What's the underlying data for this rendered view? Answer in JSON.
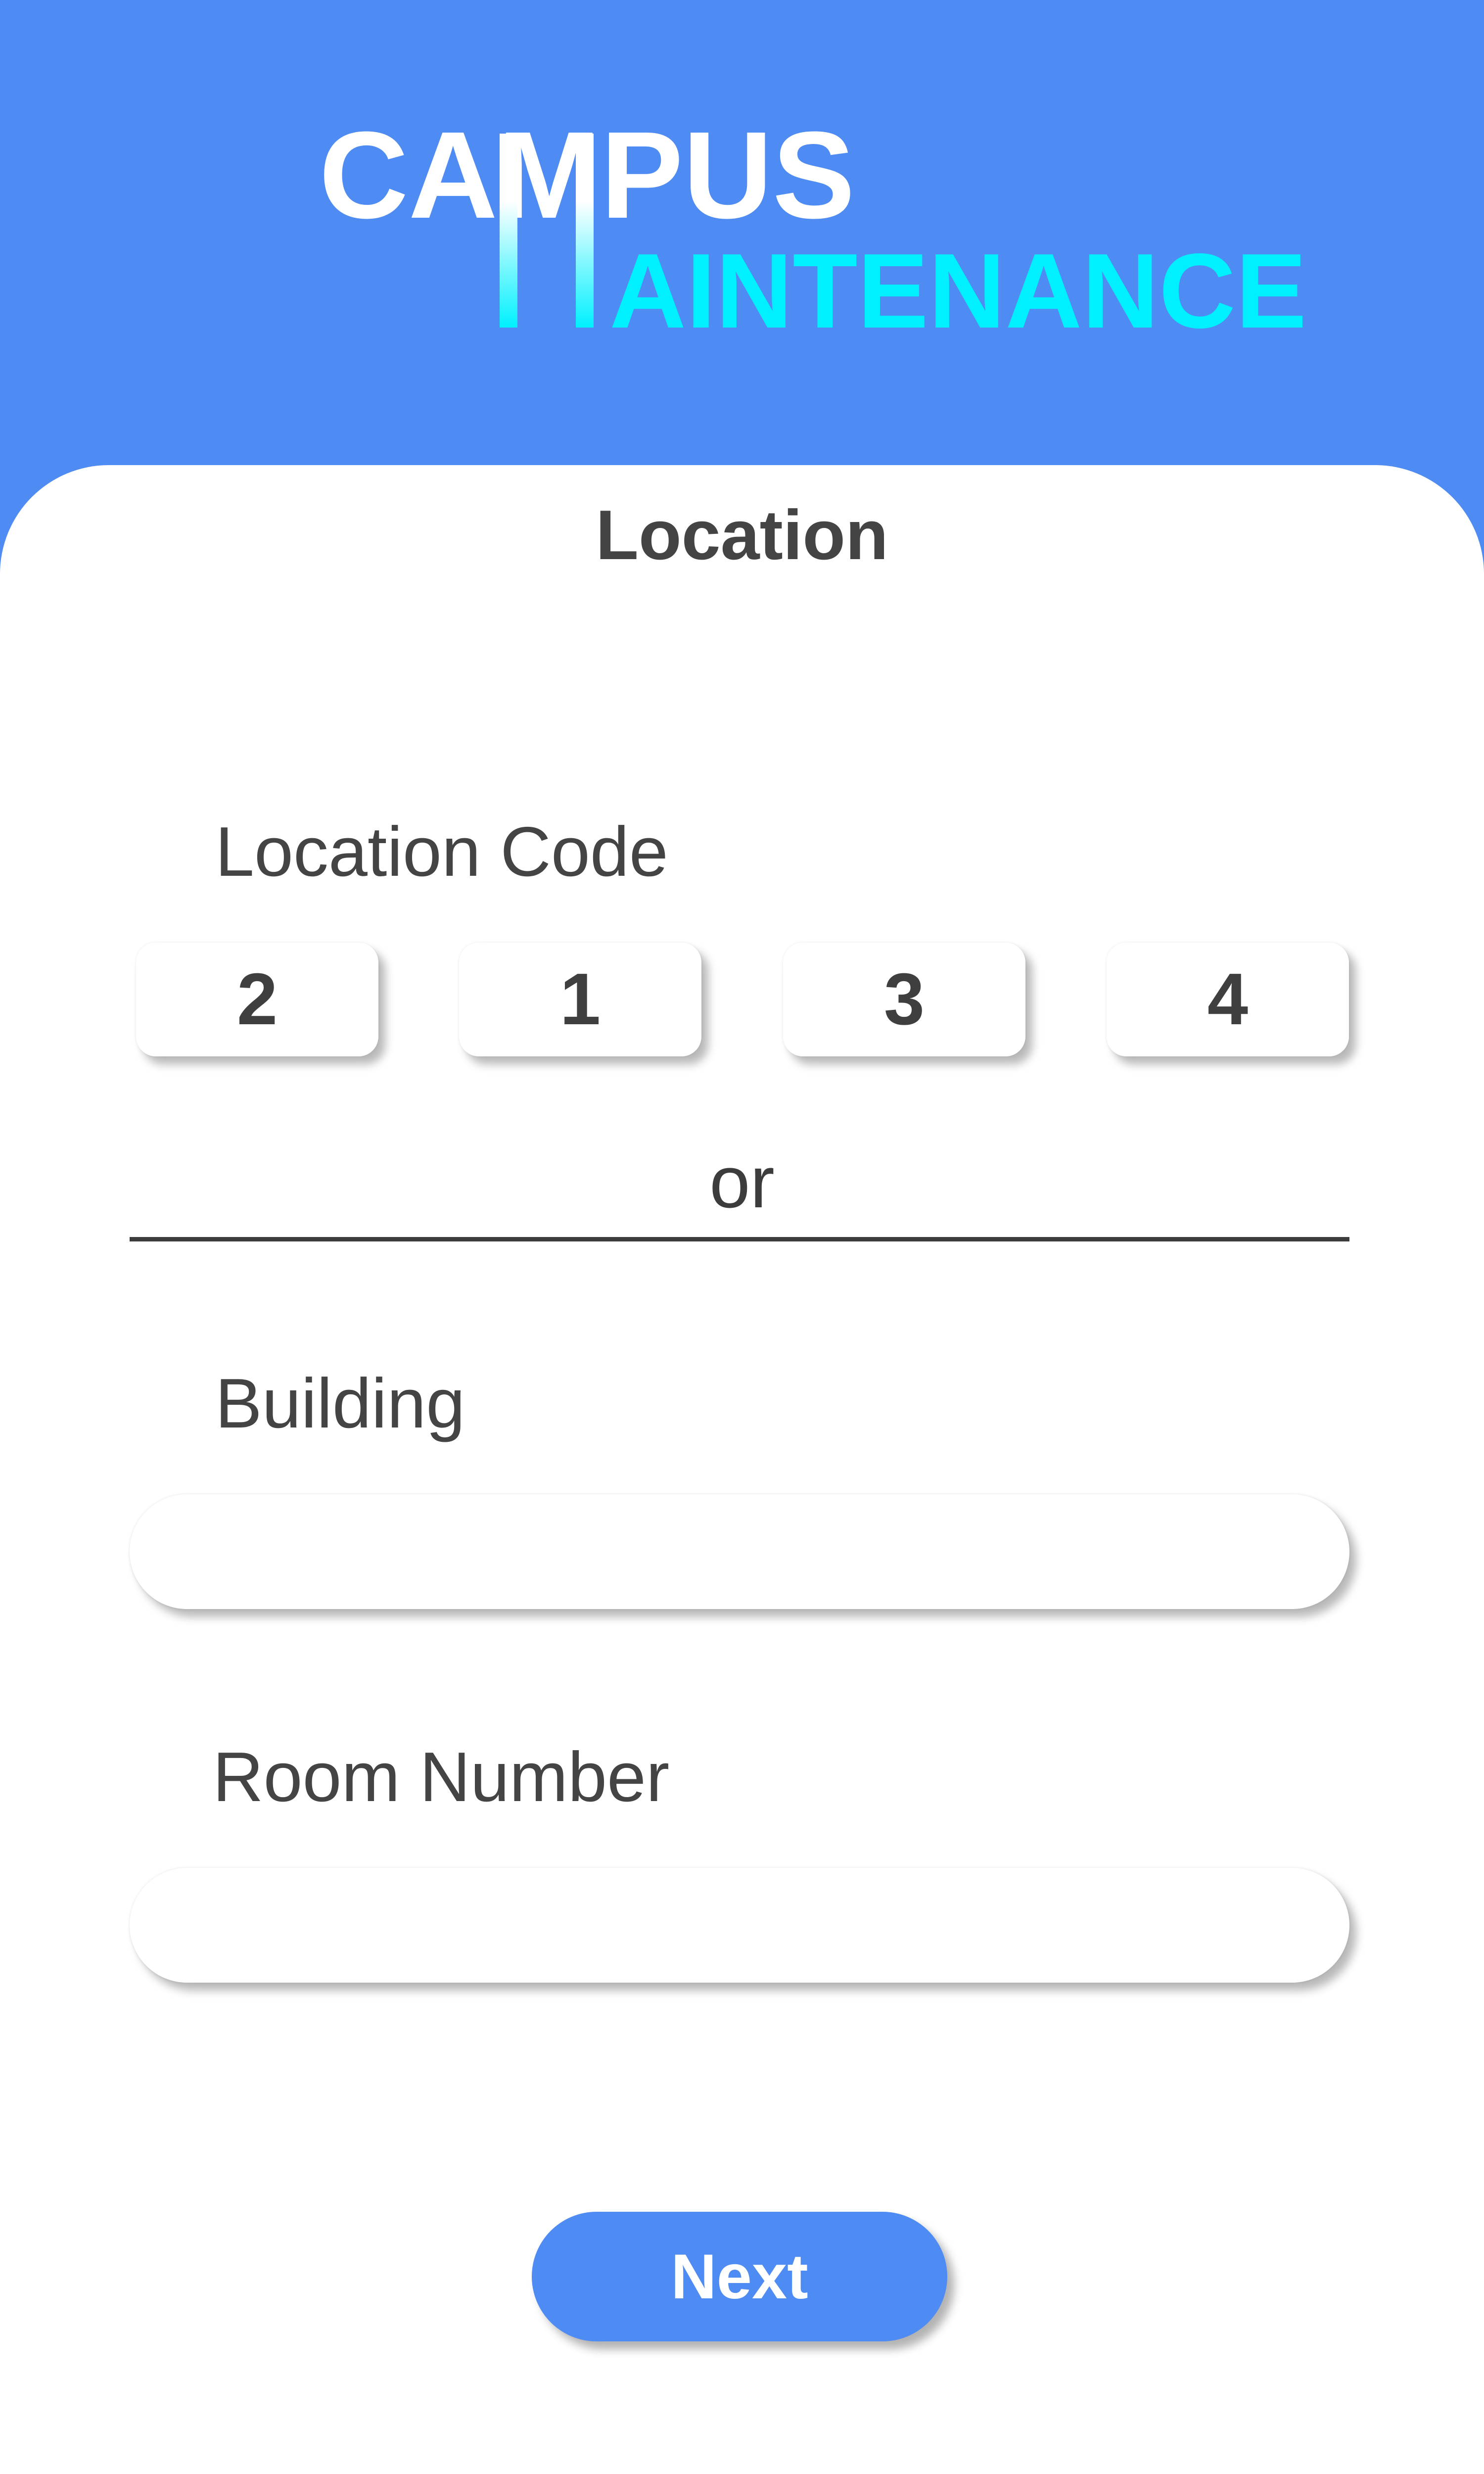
{
  "header": {
    "logo_line1": "CAMPUS",
    "logo_line2": "AINTENANCE",
    "logo_initial": "M",
    "colors": {
      "background": "#4e8bf3",
      "logo_top": "#ffffff",
      "logo_bottom": "#00f0ff"
    }
  },
  "page": {
    "title": "Location"
  },
  "location_code": {
    "label": "Location Code",
    "digits": [
      "2",
      "1",
      "3",
      "4"
    ]
  },
  "separator": {
    "text": "or"
  },
  "building": {
    "label": "Building",
    "value": ""
  },
  "room": {
    "label": "Room Number",
    "value": ""
  },
  "actions": {
    "next_label": "Next"
  },
  "colors": {
    "accent": "#4e8bf3",
    "text": "#444444",
    "card": "#ffffff"
  }
}
